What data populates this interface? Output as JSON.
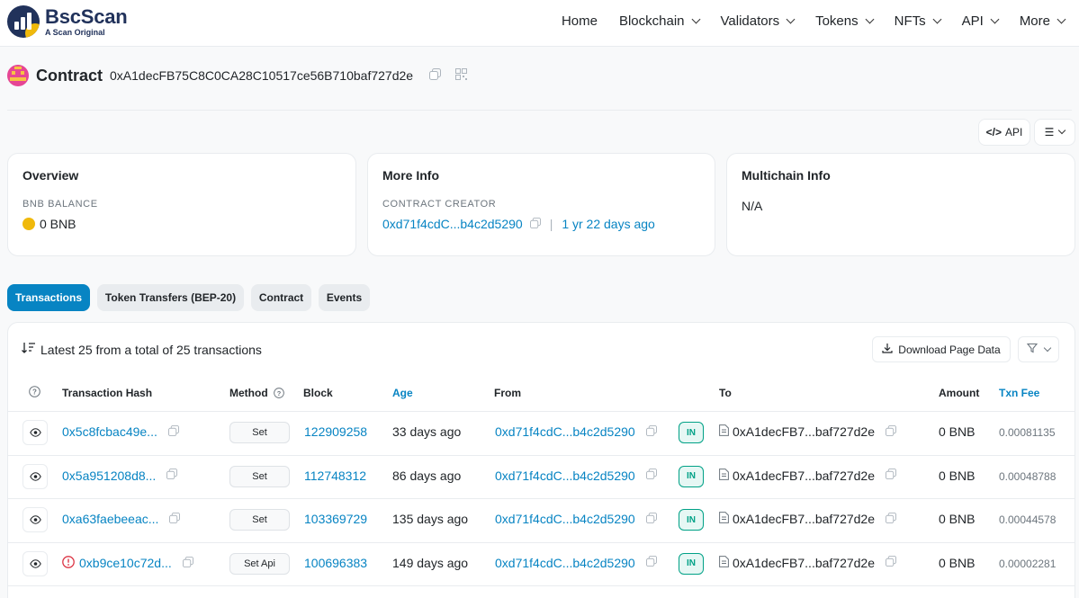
{
  "brand": {
    "name": "BscScan",
    "tagline": "A Scan Original"
  },
  "nav": [
    "Home",
    "Blockchain",
    "Validators",
    "Tokens",
    "NFTs",
    "API",
    "More"
  ],
  "contract": {
    "title": "Contract",
    "address": "0xA1decFB75C8C0CA28C10517ce56B710baf727d2e"
  },
  "toolbar": {
    "api_label": "API"
  },
  "overview": {
    "title": "Overview",
    "balance_label": "BNB BALANCE",
    "balance": "0 BNB"
  },
  "more_info": {
    "title": "More Info",
    "creator_label": "CONTRACT CREATOR",
    "creator": "0xd71f4cdC...b4c2d5290",
    "creator_age": "1 yr 22 days ago"
  },
  "multichain": {
    "title": "Multichain Info",
    "value": "N/A"
  },
  "tabs": [
    "Transactions",
    "Token Transfers (BEP-20)",
    "Contract",
    "Events"
  ],
  "table": {
    "summary": "Latest 25 from a total of 25 transactions",
    "download_label": "Download Page Data",
    "headers": [
      "Transaction Hash",
      "Method",
      "Block",
      "Age",
      "From",
      "To",
      "Amount",
      "Txn Fee"
    ],
    "rows": [
      {
        "hash": "0x5c8fcbac49e...",
        "method": "Set",
        "block": "122909258",
        "age": "33 days ago",
        "from": "0xd71f4cdC...b4c2d5290",
        "dir": "IN",
        "to": "0xA1decFB7...baf727d2e",
        "amount": "0 BNB",
        "fee": "0.00081135",
        "error": false
      },
      {
        "hash": "0x5a951208d8...",
        "method": "Set",
        "block": "112748312",
        "age": "86 days ago",
        "from": "0xd71f4cdC...b4c2d5290",
        "dir": "IN",
        "to": "0xA1decFB7...baf727d2e",
        "amount": "0 BNB",
        "fee": "0.00048788",
        "error": false
      },
      {
        "hash": "0xa63faebeeac...",
        "method": "Set",
        "block": "103369729",
        "age": "135 days ago",
        "from": "0xd71f4cdC...b4c2d5290",
        "dir": "IN",
        "to": "0xA1decFB7...baf727d2e",
        "amount": "0 BNB",
        "fee": "0.00044578",
        "error": false
      },
      {
        "hash": "0xb9ce10c72d...",
        "method": "Set Api",
        "block": "100696383",
        "age": "149 days ago",
        "from": "0xd71f4cdC...b4c2d5290",
        "dir": "IN",
        "to": "0xA1decFB7...baf727d2e",
        "amount": "0 BNB",
        "fee": "0.00002281",
        "error": true
      }
    ]
  },
  "colors": {
    "link": "#0784c3",
    "brand": "#21325b",
    "bnb": "#f0b90b",
    "in": "#00a186",
    "error": "#dc3545"
  }
}
